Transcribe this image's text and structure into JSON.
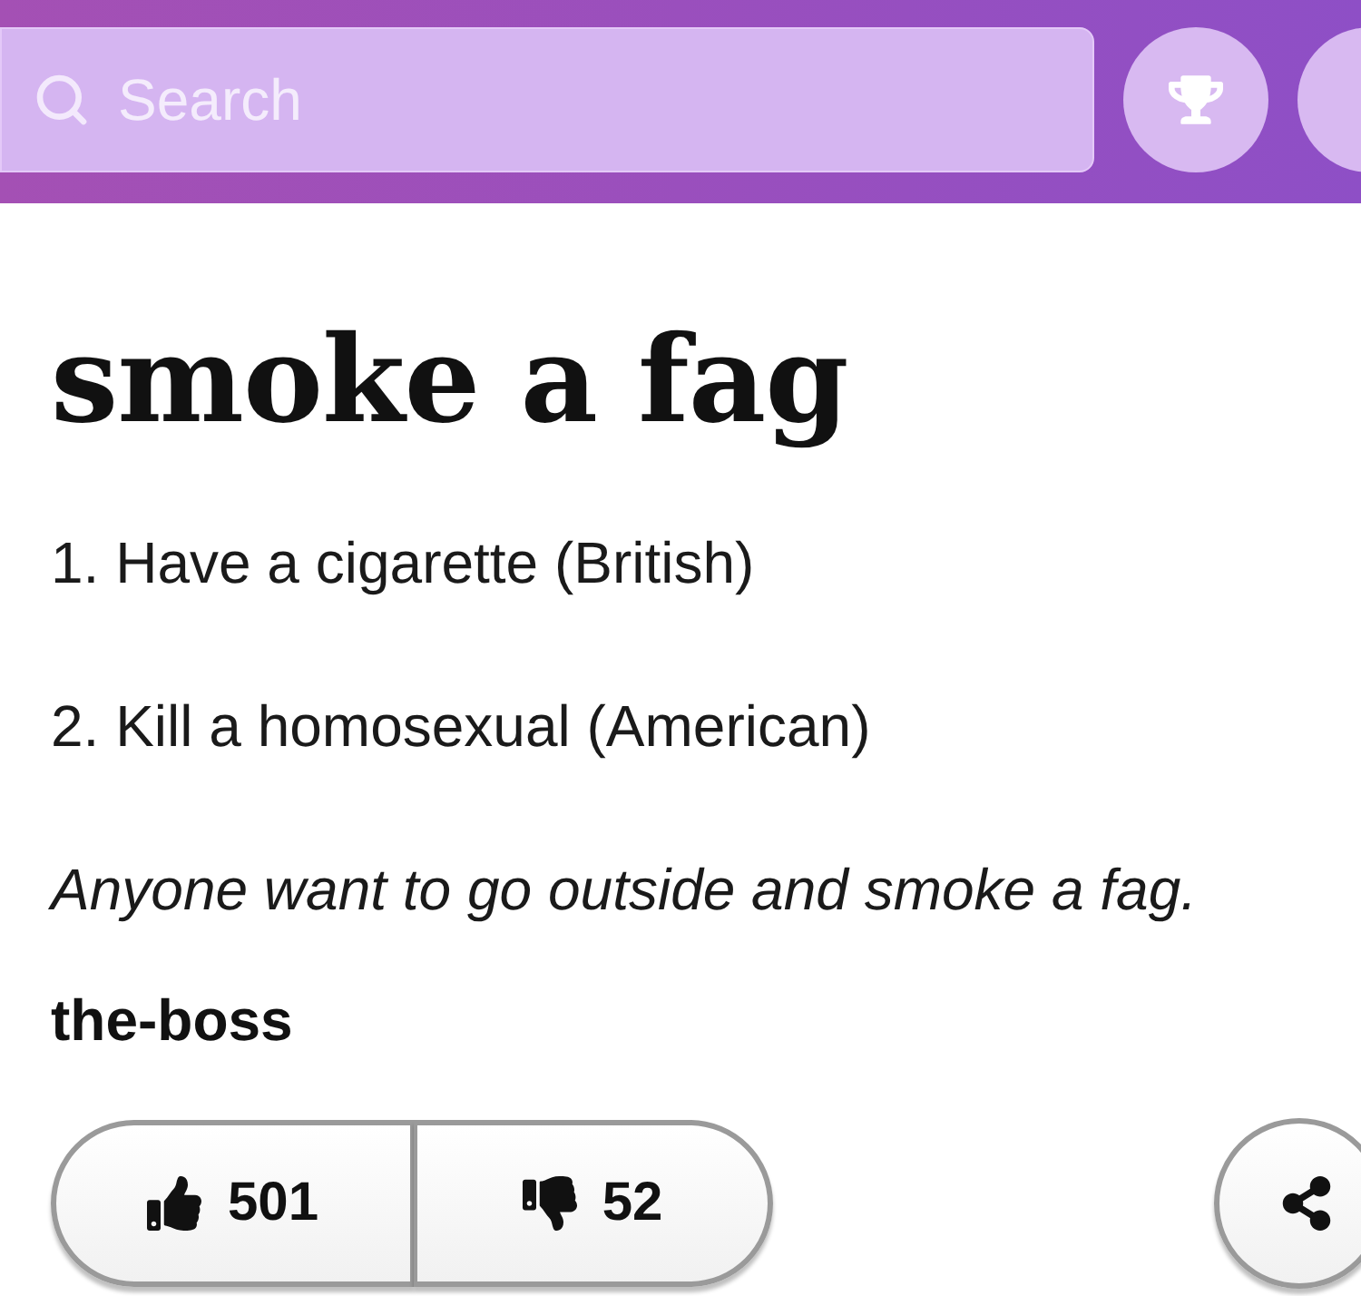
{
  "search": {
    "placeholder": "Search"
  },
  "entry": {
    "word": "smoke a fag",
    "definitions": [
      "1. Have a cigarette (British)",
      "2. Kill a homosexual (American)"
    ],
    "example": "Anyone want to go outside and smoke a fag.",
    "author": "the-boss"
  },
  "votes": [
    {
      "kind": "up",
      "count": "501"
    },
    {
      "kind": "down",
      "count": "52"
    }
  ]
}
